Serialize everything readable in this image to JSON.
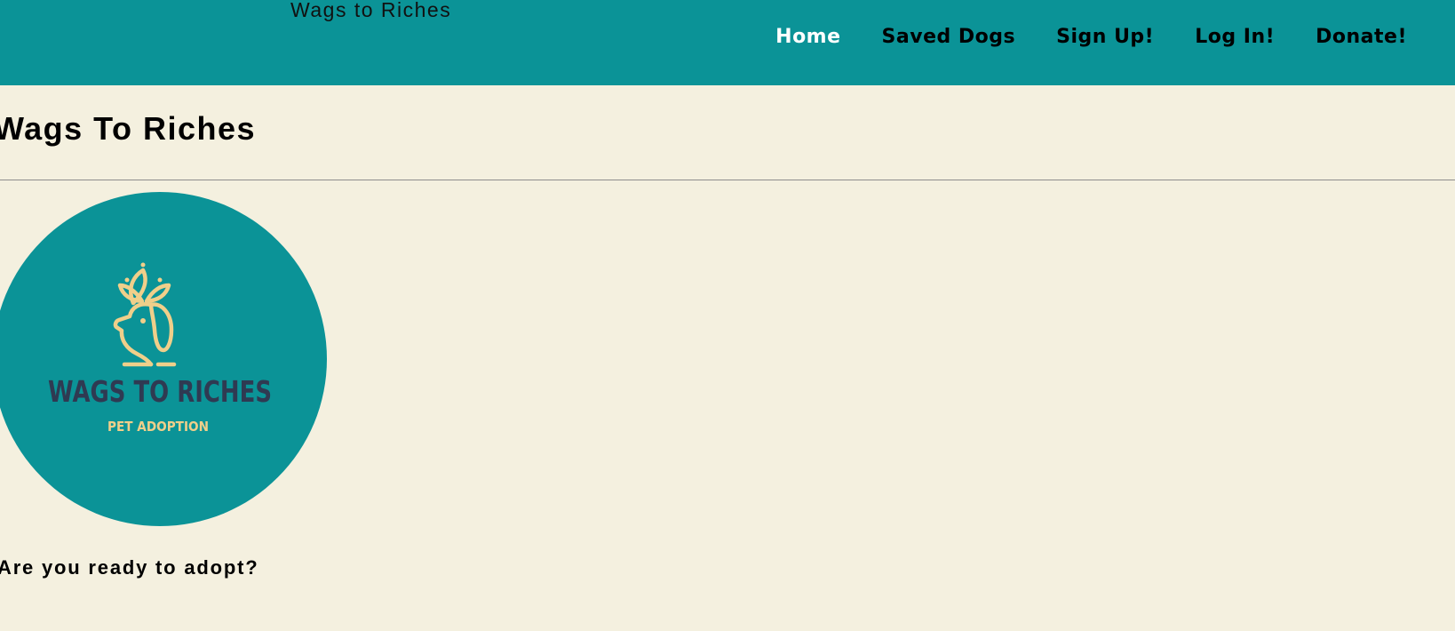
{
  "header": {
    "brand": "Wags to Riches",
    "background_color": "#0b9397",
    "nav": [
      {
        "label": "Home",
        "active": true
      },
      {
        "label": "Saved Dogs",
        "active": false
      },
      {
        "label": "Sign Up!",
        "active": false
      },
      {
        "label": "Log In!",
        "active": false
      },
      {
        "label": "Donate!",
        "active": false
      }
    ]
  },
  "main": {
    "title": "Wags To Riches",
    "logo": {
      "icon": "dog-with-crown-icon",
      "title": "WAGS TO RICHES",
      "subtitle": "PET ADOPTION",
      "circle_color": "#0b9397",
      "title_color": "#2f3a52",
      "accent_color": "#f0cf8a"
    },
    "tagline": "Are you ready to adopt?"
  },
  "colors": {
    "page_background": "#f4f0df"
  }
}
